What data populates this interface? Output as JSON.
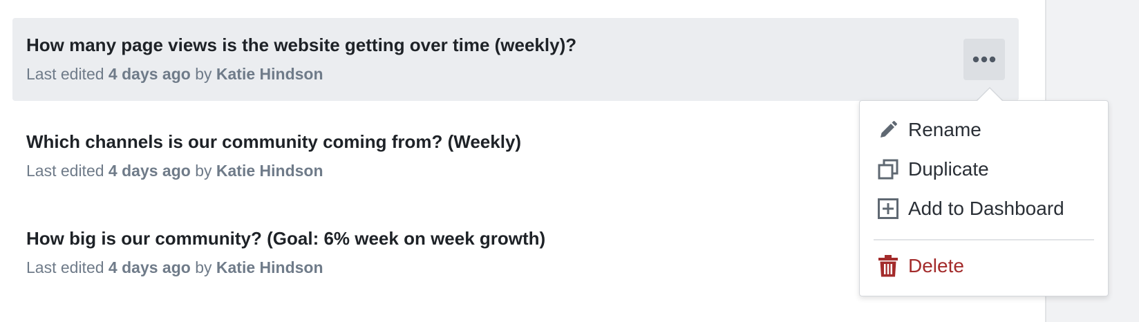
{
  "questions": [
    {
      "title": "How many page views is the website getting over time (weekly)?",
      "meta_prefix": "Last edited",
      "edited_ago": "4 days ago",
      "meta_by": "by",
      "author": "Katie Hindson"
    },
    {
      "title": "Which channels is our community coming from? (Weekly)",
      "meta_prefix": "Last edited",
      "edited_ago": "4 days ago",
      "meta_by": "by",
      "author": "Katie Hindson"
    },
    {
      "title": "How big is our community? (Goal: 6% week on week growth)",
      "meta_prefix": "Last edited",
      "edited_ago": "4 days ago",
      "meta_by": "by",
      "author": "Katie Hindson"
    }
  ],
  "menu": {
    "rename": {
      "label": "Rename",
      "icon": "pencil-icon"
    },
    "duplicate": {
      "label": "Duplicate",
      "icon": "duplicate-icon"
    },
    "add_to_dashboard": {
      "label": "Add to Dashboard",
      "icon": "add-square-icon"
    },
    "delete": {
      "label": "Delete",
      "icon": "trash-icon"
    }
  },
  "colors": {
    "row_highlight": "#ebedf0",
    "title_text": "#1e2227",
    "meta_text": "#6f7b89",
    "delete_red": "#a32b2b",
    "icon_gray": "#5f6872"
  }
}
